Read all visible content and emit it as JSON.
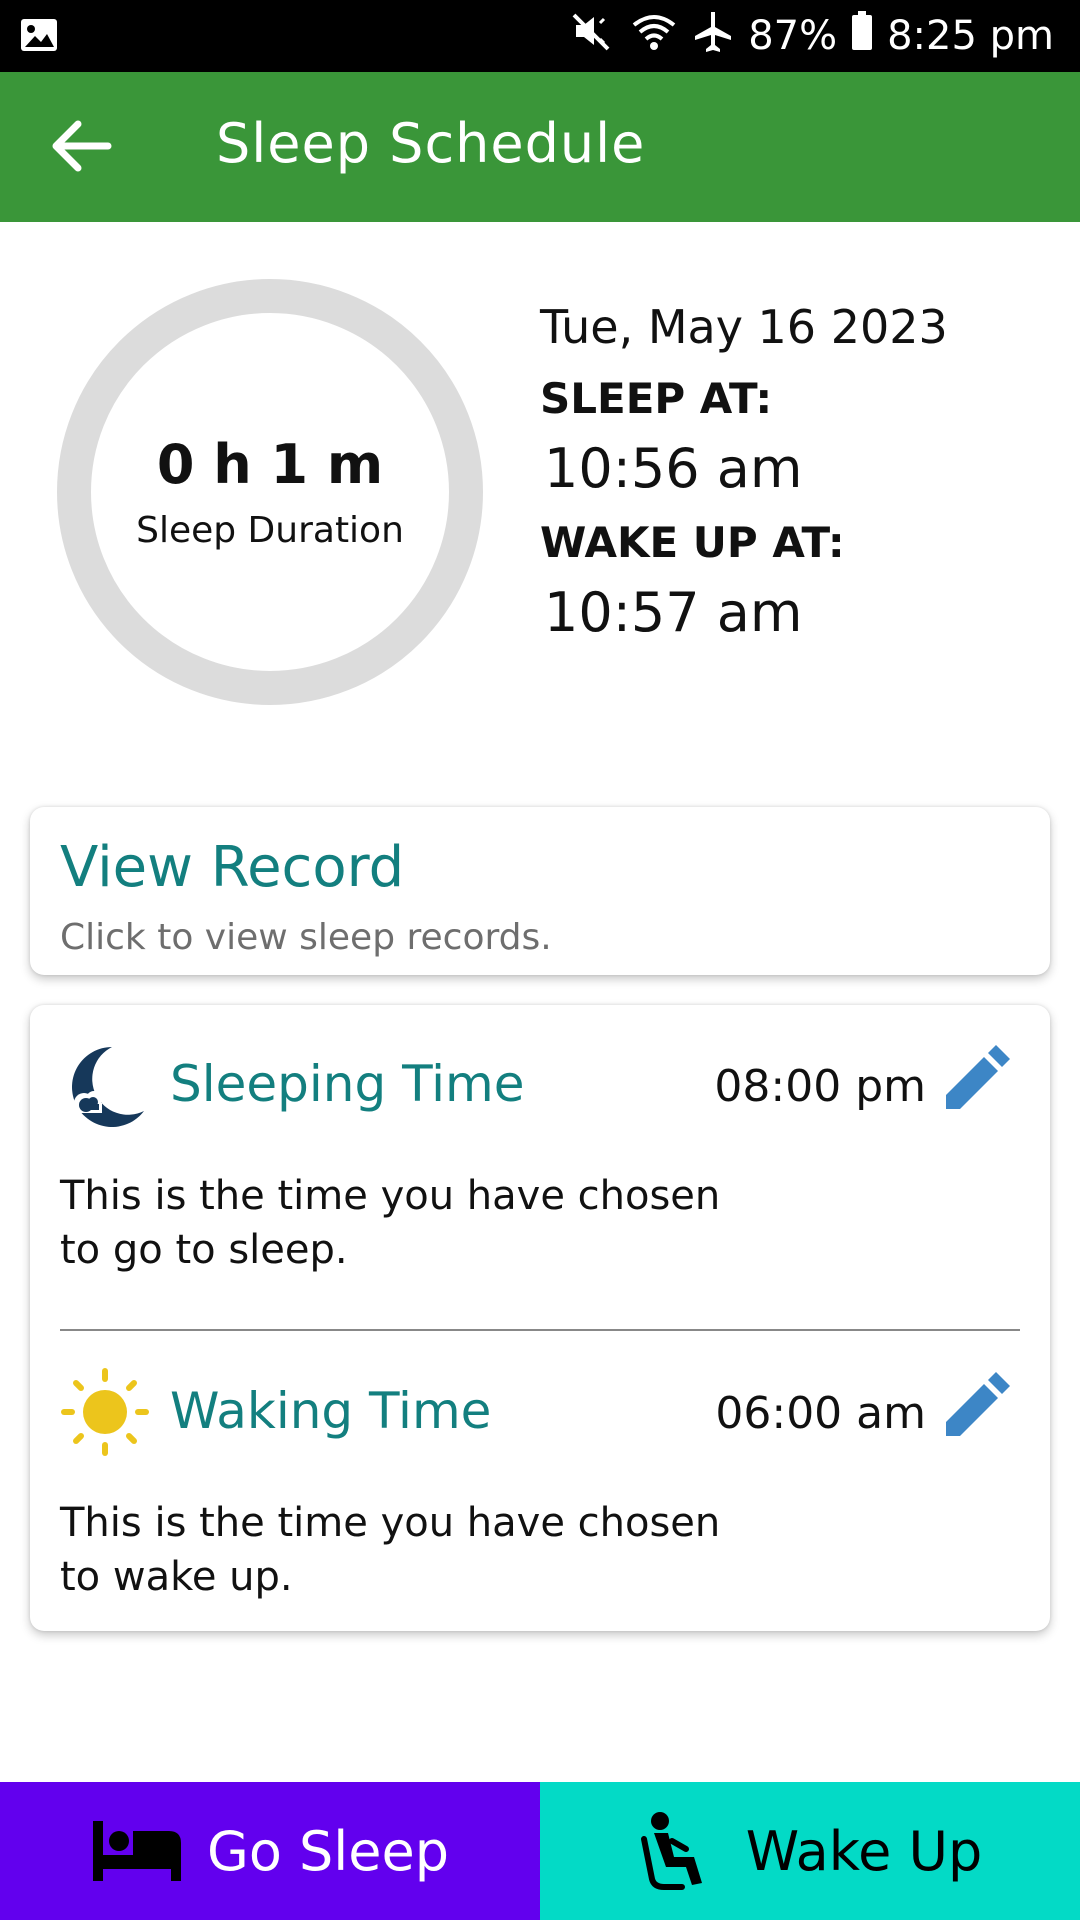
{
  "status_bar": {
    "battery": "87%",
    "time": "8:25 pm",
    "icons": [
      "image-icon",
      "mute-icon",
      "wifi-icon",
      "airplane-icon",
      "battery-icon"
    ]
  },
  "app_bar": {
    "title": "Sleep Schedule",
    "back_icon": "arrow-left-icon",
    "color": "#3a9639"
  },
  "summary": {
    "duration_value": "0 h 1 m",
    "duration_label": "Sleep Duration",
    "date": "Tue, May 16 2023",
    "sleep_at_label": "SLEEP AT:",
    "sleep_at_value": "10:56 am",
    "wake_up_label": "WAKE UP AT:",
    "wake_up_value": "10:57 am",
    "ring_color": "#dcdcdc"
  },
  "record_card": {
    "title": "View Record",
    "subtitle": "Click to view sleep records."
  },
  "schedule": {
    "sleeping": {
      "title": "Sleeping Time",
      "time": "08:00 pm",
      "description": "This is the time you have chosen to go to sleep.",
      "icon": "moon-icon"
    },
    "waking": {
      "title": "Waking Time",
      "time": "06:00 am",
      "description": "This is the time you have chosen to wake up.",
      "icon": "sun-icon"
    },
    "accent": "#137f7f",
    "edit_color": "#3d86c6"
  },
  "bottom_bar": {
    "go_sleep_label": "Go Sleep",
    "go_sleep_color": "#6200ee",
    "wake_up_label": "Wake Up",
    "wake_up_color": "#03dac6"
  }
}
